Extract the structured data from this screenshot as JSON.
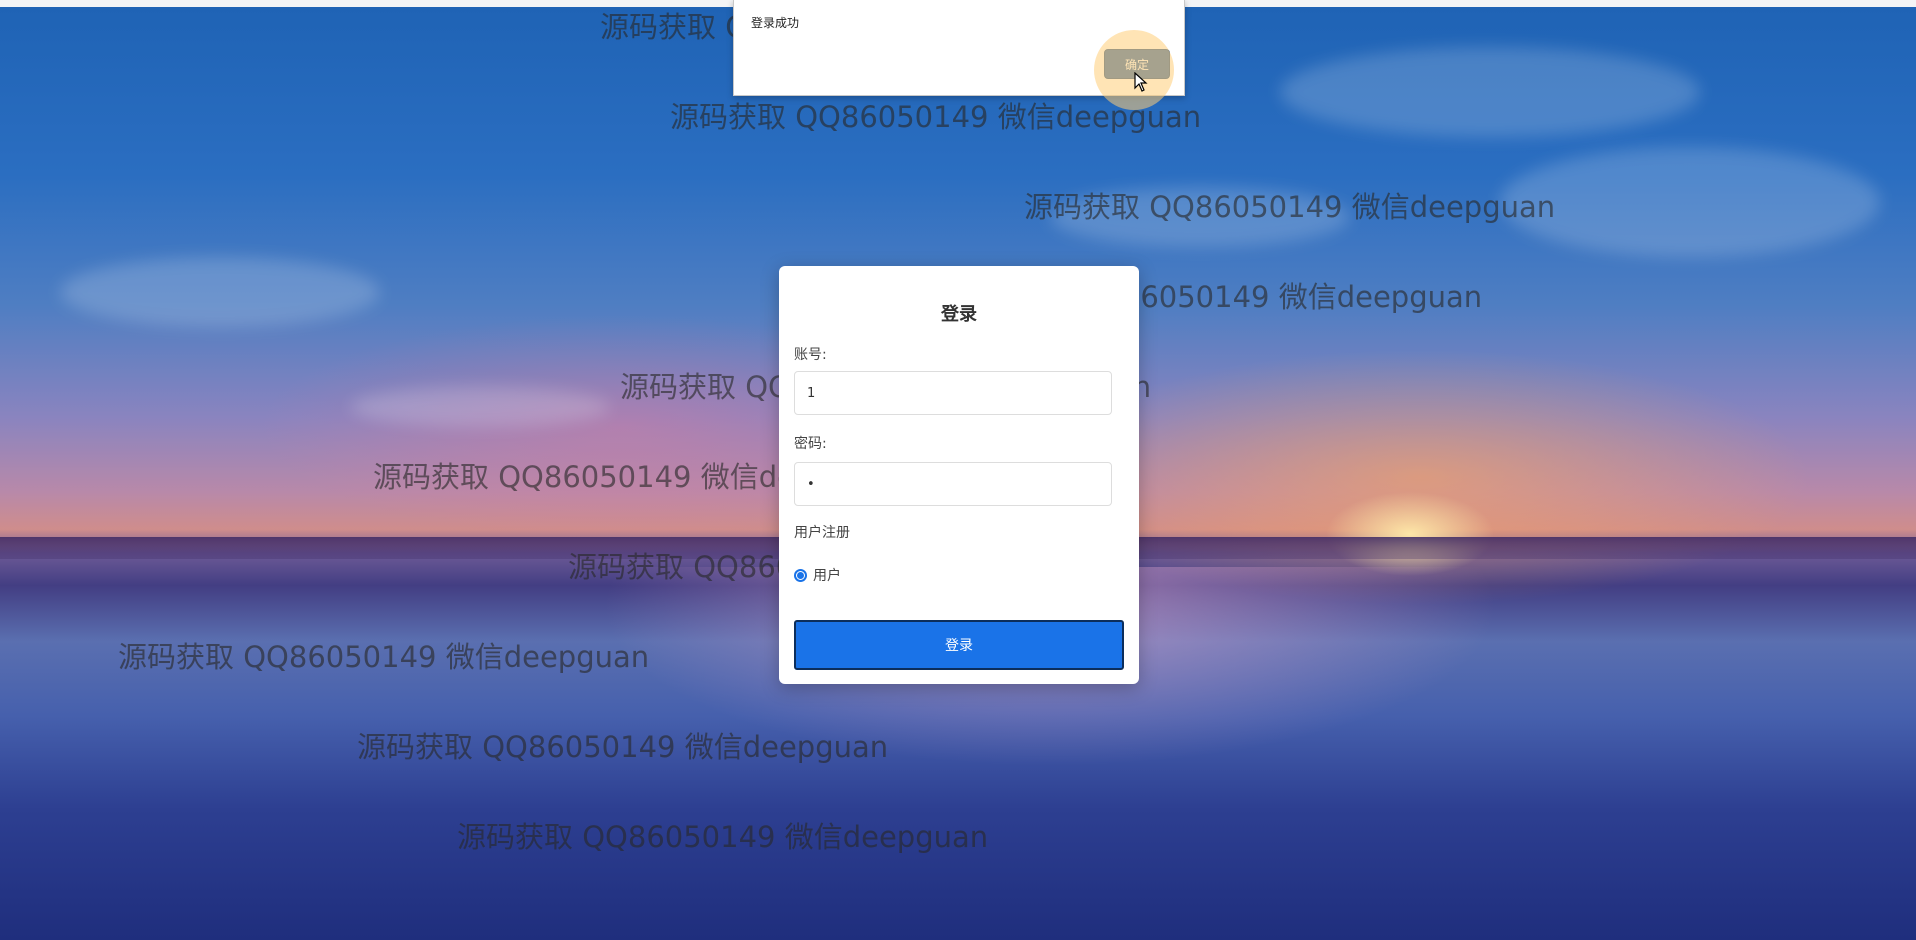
{
  "alert": {
    "message": "登录成功",
    "ok_label": "确定"
  },
  "login": {
    "title": "登录",
    "account_label": "账号:",
    "account_value": "1",
    "password_label": "密码:",
    "password_value": "•",
    "register_label": "用户注册",
    "role_option": "用户",
    "submit_label": "登录"
  },
  "watermarks": [
    "源码获取 QQ86050149 微信deepguan",
    "源码获取 QQ86050149 微信deepguan",
    "源码获取 QQ86050149 微信deepguan",
    "源码获取 QQ86050149 微信deepguan",
    "源码获取 QQ86050149 微信deepguan",
    "源码获取 QQ86050149 微信deepguan",
    "源码获取 QQ86050149 微信deepguan",
    "源码获取 QQ86050149 微信deepguan",
    "源码获取 QQ86050149 微信deepguan",
    "源码获取 QQ86050149 微信deepguan"
  ]
}
